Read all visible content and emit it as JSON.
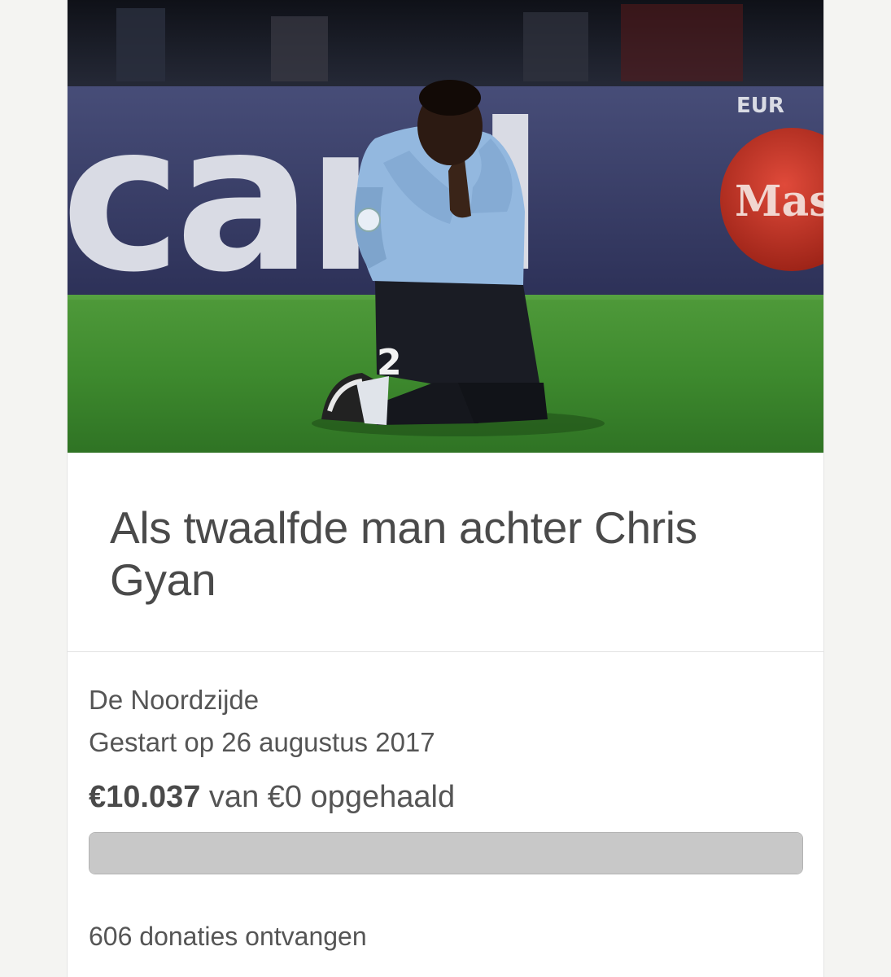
{
  "campaign": {
    "title": "Als twaalfde man achter Chris Gyan",
    "organizer": "De Noordzijde",
    "started": "Gestart op 26 augustus 2017",
    "raised_amount": "€10.037",
    "raised_suffix": " van €0 opgehaald",
    "progress_fraction": 1.0,
    "donations": "606 donaties ontvangen"
  },
  "hero_image": {
    "banner_text": "card",
    "logo_text": "Mas",
    "corner_text": "EUR",
    "shirt_number": "2",
    "colors": {
      "sky": "#1c1f2a",
      "banner": "#3a3f66",
      "grass": "#3e8a2e",
      "shirt": "#8fb6dd",
      "accent_red": "#c0392b"
    }
  },
  "colors": {
    "page_bg": "#f4f4f2",
    "card_bg": "#ffffff",
    "text": "#555555",
    "progress_track": "#c8c8c8"
  }
}
